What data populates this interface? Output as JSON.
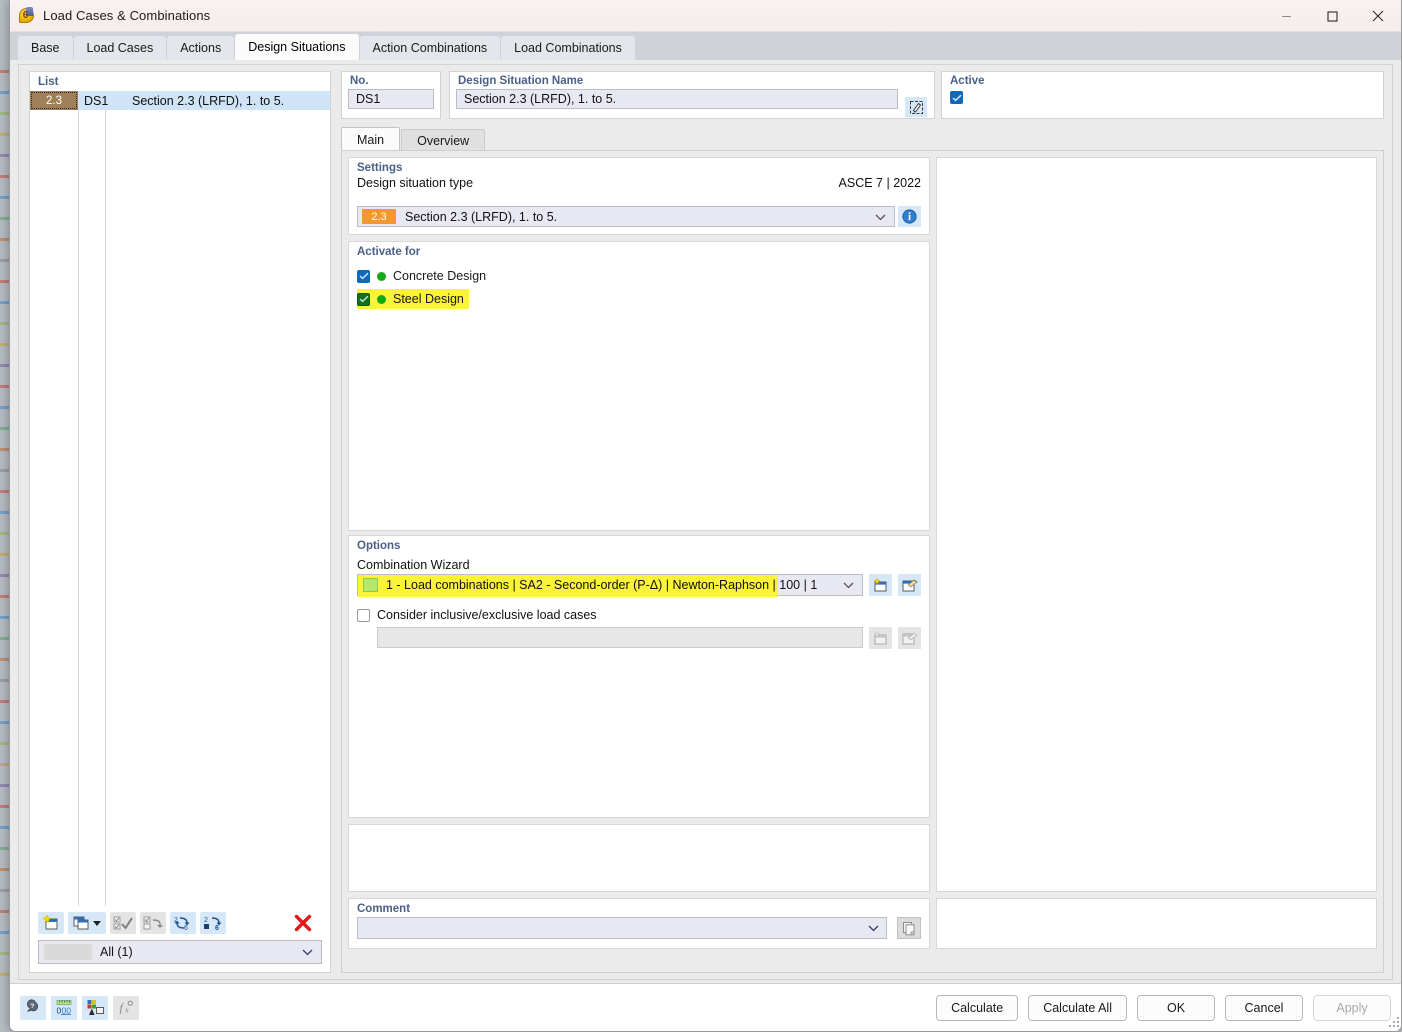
{
  "window": {
    "title": "Load Cases & Combinations",
    "icon": "load-case-icon",
    "minimize": "minimize-icon",
    "maximize": "maximize-icon",
    "close": "close-icon"
  },
  "top_tabs": [
    {
      "label": "Base",
      "active": false
    },
    {
      "label": "Load Cases",
      "active": false
    },
    {
      "label": "Actions",
      "active": false
    },
    {
      "label": "Design Situations",
      "active": true
    },
    {
      "label": "Action Combinations",
      "active": false
    },
    {
      "label": "Load Combinations",
      "active": false
    }
  ],
  "list_panel": {
    "header": "List",
    "row": {
      "no": "2.3",
      "id": "DS1",
      "name": "Section 2.3 (LRFD), 1. to 5."
    },
    "toolbar": [
      {
        "name": "new-item-button",
        "enabled": true
      },
      {
        "name": "copy-item-button",
        "enabled": true
      },
      {
        "name": "select-all-button",
        "enabled": false
      },
      {
        "name": "invert-selection-button",
        "enabled": false
      },
      {
        "name": "renumber-button",
        "enabled": true
      },
      {
        "name": "sort-button",
        "enabled": true
      },
      {
        "name": "delete-button",
        "enabled": true
      }
    ],
    "filter": {
      "value": "All (1)"
    }
  },
  "header": {
    "no_label": "No.",
    "no_value": "DS1",
    "name_label": "Design Situation Name",
    "name_value": "Section 2.3 (LRFD), 1. to 5.",
    "edit_icon": "edit-pencil-icon",
    "active_label": "Active",
    "active_checked": true
  },
  "inner_tabs": [
    {
      "label": "Main",
      "active": true
    },
    {
      "label": "Overview",
      "active": false
    }
  ],
  "settings": {
    "title": "Settings",
    "type_label": "Design situation type",
    "standard": "ASCE 7 | 2022",
    "type_badge": "2.3",
    "type_value": "Section 2.3 (LRFD), 1. to 5.",
    "info_icon": "info-icon"
  },
  "activate_for": {
    "title": "Activate for",
    "items": [
      {
        "label": "Concrete Design",
        "checked": true,
        "highlighted": false,
        "dot_color": "#14a914"
      },
      {
        "label": "Steel Design",
        "checked": true,
        "highlighted": true,
        "dot_color": "#14a914"
      }
    ]
  },
  "options": {
    "title": "Options",
    "wizard_label": "Combination Wizard",
    "wizard_value": "1 - Load combinations | SA2 - Second-order (P-Δ) | Newton-Raphson | 100 | 1",
    "wizard_highlighted": true,
    "new_wizard_icon": "new-wizard-icon",
    "edit_wizard_icon": "edit-wizard-icon",
    "inclusive_label": "Consider inclusive/exclusive load cases",
    "inclusive_checked": false,
    "inclusive_value": "",
    "inclusive_new_icon": "new-item-icon",
    "inclusive_edit_icon": "edit-item-icon"
  },
  "comment": {
    "title": "Comment",
    "value": "",
    "copy_icon": "copy-icon"
  },
  "footer": {
    "tools": [
      {
        "name": "help-tool-icon",
        "enabled": true
      },
      {
        "name": "units-tool-icon",
        "enabled": true
      },
      {
        "name": "display-properties-tool-icon",
        "enabled": true
      },
      {
        "name": "formula-tool-icon",
        "enabled": false
      }
    ],
    "buttons": [
      {
        "label": "Calculate",
        "enabled": true,
        "name": "calculate-button"
      },
      {
        "label": "Calculate All",
        "enabled": true,
        "name": "calculate-all-button"
      },
      {
        "label": "OK",
        "enabled": true,
        "name": "ok-button"
      },
      {
        "label": "Cancel",
        "enabled": true,
        "name": "cancel-button"
      },
      {
        "label": "Apply",
        "enabled": false,
        "name": "apply-button"
      }
    ]
  },
  "colors": {
    "accent": "#0f68b8",
    "highlight": "#fbf23a",
    "badge_orange": "#f2982f",
    "row_selected": "#cfe4f7",
    "row_num_brown": "#a08058",
    "green_check": "#13701f",
    "panel_title": "#4b6088"
  }
}
